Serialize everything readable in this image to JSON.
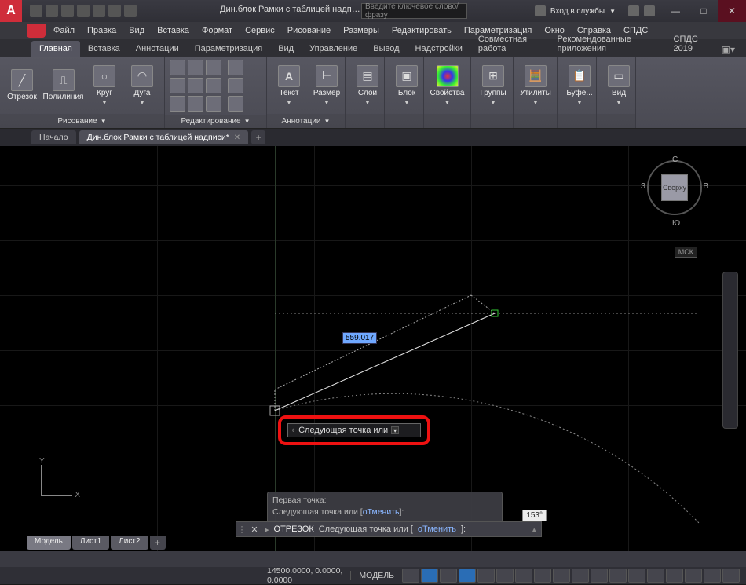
{
  "title": {
    "doc": "Дин.блок Рамки с таблицей надписи...",
    "search_placeholder": "Введите ключевое слово/фразу",
    "login": "Вход в службы"
  },
  "menu": [
    "Файл",
    "Правка",
    "Вид",
    "Вставка",
    "Формат",
    "Сервис",
    "Рисование",
    "Размеры",
    "Редактировать",
    "Параметризация",
    "Окно",
    "Справка",
    "СПДС"
  ],
  "ribbon_tabs": [
    "Главная",
    "Вставка",
    "Аннотации",
    "Параметризация",
    "Вид",
    "Управление",
    "Вывод",
    "Надстройки",
    "Совместная работа",
    "Рекомендованные приложения",
    "СПДС 2019"
  ],
  "ribbon": {
    "draw": {
      "title": "Рисование",
      "otrezok": "Отрезок",
      "polyline": "Полилиния",
      "circle": "Круг",
      "arc": "Дуга"
    },
    "modify": {
      "title": "Редактирование"
    },
    "annot": {
      "title": "Аннотации",
      "text": "Текст",
      "dim": "Размер"
    },
    "layers": {
      "title": "Слои",
      "btn": "Слои"
    },
    "block": {
      "title": "Блок",
      "btn": "Блок"
    },
    "props": {
      "title": "Свойства",
      "btn": "Свойства"
    },
    "groups": {
      "title": "Группы",
      "btn": "Группы"
    },
    "utils": {
      "title": "Утилиты",
      "btn": "Утилиты"
    },
    "clip": {
      "title": "Буфе...",
      "btn": "Буфе..."
    },
    "view": {
      "title": "Вид",
      "btn": "Вид"
    }
  },
  "doc_tabs": {
    "start": "Начало",
    "doc": "Дин.блок Рамки с таблицей надписи*"
  },
  "viewcube": {
    "top": "Сверху",
    "n": "С",
    "s": "Ю",
    "w": "З",
    "e": "В",
    "wcs": "МСК"
  },
  "dyn": {
    "dim": "559.017",
    "prompt": "Следующая точка или"
  },
  "cmd": {
    "hist1": "Первая точка:",
    "hist2_a": "Следующая точка или [",
    "hist2_b": "оТменить",
    "hist2_c": "]:",
    "cmd": "ОТРЕЗОК",
    "prompt": "Следующая точка или [",
    "opt": "оТменить",
    "suffix": "]:",
    "angle": "153°"
  },
  "layout": {
    "model": "Модель",
    "l1": "Лист1",
    "l2": "Лист2"
  },
  "status": {
    "coords": "14500.0000, 0.0000, 0.0000",
    "space": "МОДЕЛЬ"
  },
  "axes": {
    "x": "X",
    "y": "Y"
  }
}
